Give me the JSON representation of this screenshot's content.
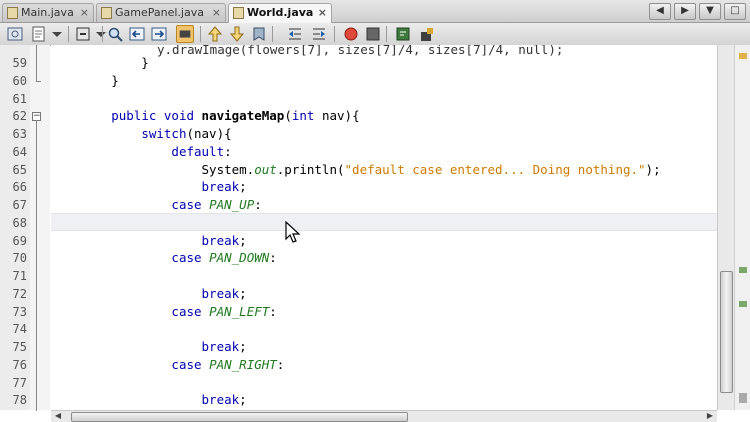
{
  "tabs": [
    {
      "label": "Main.java",
      "active": false
    },
    {
      "label": "GamePanel.java",
      "active": false
    },
    {
      "label": "World.java",
      "active": true
    }
  ],
  "window_controls": [
    "◀",
    "▶",
    "▼",
    "□"
  ],
  "toolbar_icons": [
    "history-icon",
    "source-icon",
    "dropdown-icon",
    "find-icon",
    "back-icon",
    "forward-icon",
    "toggle-highlight-icon",
    "prev-bookmark-icon",
    "next-bookmark-icon",
    "toggle-bookmark-icon",
    "shift-left-icon",
    "shift-right-icon",
    "start-macro-icon",
    "stop-macro-icon",
    "comment-icon",
    "uncomment-icon"
  ],
  "gutter_partial_top_line": "y.drawImage(flowers[7], sizes[7]/4, sizes[7]/4, null);",
  "lines": [
    {
      "num": "59",
      "tokens": [
        {
          "t": "            }",
          "c": ""
        }
      ]
    },
    {
      "num": "60",
      "tokens": [
        {
          "t": "        }",
          "c": ""
        }
      ]
    },
    {
      "num": "61",
      "tokens": [
        {
          "t": "",
          "c": ""
        }
      ]
    },
    {
      "num": "62",
      "tokens": [
        {
          "t": "        ",
          "c": ""
        },
        {
          "t": "public",
          "c": "kw"
        },
        {
          "t": " ",
          "c": ""
        },
        {
          "t": "void",
          "c": "kw"
        },
        {
          "t": " ",
          "c": ""
        },
        {
          "t": "navigateMap",
          "c": "bold"
        },
        {
          "t": "(",
          "c": ""
        },
        {
          "t": "int",
          "c": "kw"
        },
        {
          "t": " nav){",
          "c": ""
        }
      ]
    },
    {
      "num": "63",
      "tokens": [
        {
          "t": "            ",
          "c": ""
        },
        {
          "t": "switch",
          "c": "kw"
        },
        {
          "t": "(nav){",
          "c": ""
        }
      ]
    },
    {
      "num": "64",
      "tokens": [
        {
          "t": "                ",
          "c": ""
        },
        {
          "t": "default",
          "c": "kw"
        },
        {
          "t": ":",
          "c": ""
        }
      ]
    },
    {
      "num": "65",
      "tokens": [
        {
          "t": "                    System.",
          "c": ""
        },
        {
          "t": "out",
          "c": "fld"
        },
        {
          "t": ".println(",
          "c": ""
        },
        {
          "t": "\"default case entered... Doing nothing.\"",
          "c": "str"
        },
        {
          "t": ");",
          "c": ""
        }
      ]
    },
    {
      "num": "66",
      "tokens": [
        {
          "t": "                    ",
          "c": ""
        },
        {
          "t": "break",
          "c": "kw"
        },
        {
          "t": ";",
          "c": ""
        }
      ]
    },
    {
      "num": "67",
      "tokens": [
        {
          "t": "                ",
          "c": ""
        },
        {
          "t": "case",
          "c": "kw"
        },
        {
          "t": " ",
          "c": ""
        },
        {
          "t": "PAN_UP",
          "c": "cnst"
        },
        {
          "t": ":",
          "c": ""
        }
      ]
    },
    {
      "num": "68",
      "tokens": [
        {
          "t": "",
          "c": ""
        }
      ]
    },
    {
      "num": "69",
      "tokens": [
        {
          "t": "                    ",
          "c": ""
        },
        {
          "t": "break",
          "c": "kw"
        },
        {
          "t": ";",
          "c": ""
        }
      ]
    },
    {
      "num": "70",
      "tokens": [
        {
          "t": "                ",
          "c": ""
        },
        {
          "t": "case",
          "c": "kw"
        },
        {
          "t": " ",
          "c": ""
        },
        {
          "t": "PAN_DOWN",
          "c": "cnst"
        },
        {
          "t": ":",
          "c": ""
        }
      ]
    },
    {
      "num": "71",
      "tokens": [
        {
          "t": "",
          "c": ""
        }
      ]
    },
    {
      "num": "72",
      "tokens": [
        {
          "t": "                    ",
          "c": ""
        },
        {
          "t": "break",
          "c": "kw"
        },
        {
          "t": ";",
          "c": ""
        }
      ]
    },
    {
      "num": "73",
      "tokens": [
        {
          "t": "                ",
          "c": ""
        },
        {
          "t": "case",
          "c": "kw"
        },
        {
          "t": " ",
          "c": ""
        },
        {
          "t": "PAN_LEFT",
          "c": "cnst"
        },
        {
          "t": ":",
          "c": ""
        }
      ]
    },
    {
      "num": "74",
      "tokens": [
        {
          "t": "",
          "c": ""
        }
      ]
    },
    {
      "num": "75",
      "tokens": [
        {
          "t": "                    ",
          "c": ""
        },
        {
          "t": "break",
          "c": "kw"
        },
        {
          "t": ";",
          "c": ""
        }
      ]
    },
    {
      "num": "76",
      "tokens": [
        {
          "t": "                ",
          "c": ""
        },
        {
          "t": "case",
          "c": "kw"
        },
        {
          "t": " ",
          "c": ""
        },
        {
          "t": "PAN_RIGHT",
          "c": "cnst"
        },
        {
          "t": ":",
          "c": ""
        }
      ]
    },
    {
      "num": "77",
      "tokens": [
        {
          "t": "",
          "c": ""
        }
      ]
    },
    {
      "num": "78",
      "tokens": [
        {
          "t": "                    ",
          "c": ""
        },
        {
          "t": "break",
          "c": "kw"
        },
        {
          "t": ";",
          "c": ""
        }
      ]
    }
  ],
  "colors": {
    "keyword": "#0000b0",
    "string": "#ce7b00",
    "constant": "#1f7a1f",
    "toolbar_selected": "#f3c36b"
  }
}
